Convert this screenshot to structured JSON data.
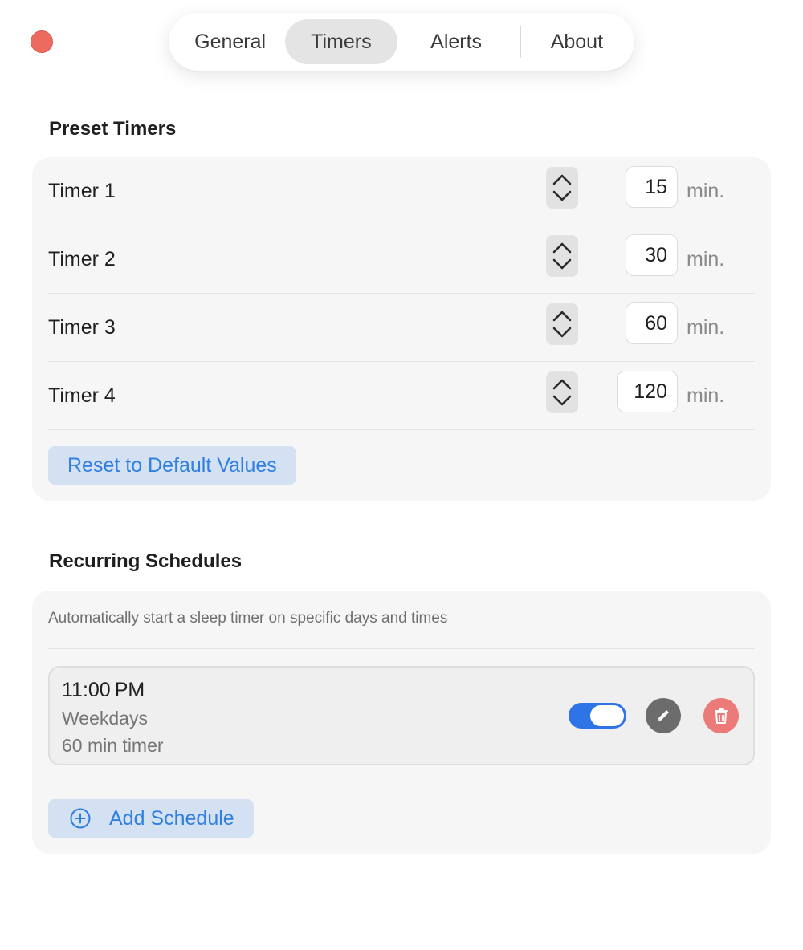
{
  "window": {
    "close_icon": "close-icon",
    "close_color": "#ec6a5e"
  },
  "tabs": [
    {
      "label": "General",
      "active": false
    },
    {
      "label": "Timers",
      "active": true
    },
    {
      "label": "Alerts",
      "active": false
    },
    {
      "label": "About",
      "active": false
    }
  ],
  "preset": {
    "title": "Preset Timers",
    "timers": [
      {
        "label": "Timer 1",
        "value": "15",
        "unit": "min."
      },
      {
        "label": "Timer 2",
        "value": "30",
        "unit": "min."
      },
      {
        "label": "Timer 3",
        "value": "60",
        "unit": "min."
      },
      {
        "label": "Timer 4",
        "value": "120",
        "unit": "min."
      }
    ],
    "reset_label": "Reset to Default Values"
  },
  "recurring": {
    "title": "Recurring Schedules",
    "description": "Automatically start a sleep timer on specific days and times",
    "schedules": [
      {
        "time": "11:00 PM",
        "days": "Weekdays",
        "duration": "60 min timer",
        "enabled": true
      }
    ],
    "add_label": "Add Schedule"
  },
  "colors": {
    "accent": "#2f74e6",
    "accent_text": "#2f7fe0",
    "button_bg": "#d3e1f3",
    "delete": "#ec7a78",
    "edit": "#6c6c6c"
  },
  "icons": {
    "stepper_up": "chevron-up-icon",
    "stepper_down": "chevron-down-icon",
    "edit": "pencil-icon",
    "delete": "trash-icon",
    "add": "plus-circle-icon"
  }
}
